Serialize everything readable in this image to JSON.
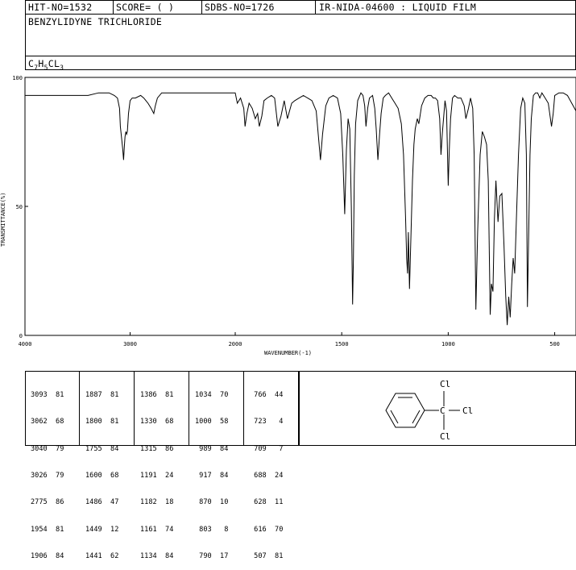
{
  "header": {
    "hit_no": "HIT-NO=1532",
    "score": "SCORE=  (   )",
    "sdbs_no": "SDBS-NO=1726",
    "ir_nida": "IR-NIDA-04600 : LIQUID FILM",
    "compound_name": "BENZYLIDYNE TRICHLORIDE",
    "formula_c": "C",
    "formula_7": "7",
    "formula_h": "H",
    "formula_5": "5",
    "formula_cl": "CL",
    "formula_3": "3"
  },
  "axes": {
    "ylabel": "TRANSMITTANCE(%)",
    "xlabel": "WAVENUMBER(-1)",
    "y_ticks": [
      "100",
      "50",
      "0"
    ],
    "x_ticks": [
      "4000",
      "3000",
      "2000",
      "1500",
      "1000",
      "500"
    ]
  },
  "peaks": {
    "col1": [
      "3093  81",
      "3062  68",
      "3040  79",
      "3026  79",
      "2775  86",
      "1954  81",
      "1906  84"
    ],
    "col2": [
      "1887  81",
      "1800  81",
      "1755  84",
      "1600  68",
      "1486  47",
      "1449  12",
      "1441  62"
    ],
    "col3": [
      "1386  81",
      "1330  68",
      "1315  86",
      "1191  24",
      "1182  18",
      "1161  74",
      "1134  84"
    ],
    "col4": [
      "1034  70",
      "1000  58",
      " 989  84",
      " 917  84",
      " 870  10",
      " 803   8",
      " 790  17"
    ],
    "col5": [
      " 766  44",
      " 723   4",
      " 709   7",
      " 688  24",
      " 628  11",
      " 616  70",
      " 507  81"
    ]
  },
  "structure": {
    "cl_top": "Cl",
    "cl_right": "Cl",
    "cl_bottom": "Cl"
  },
  "chart_data": {
    "type": "line",
    "xlabel": "WAVENUMBER(-1)",
    "ylabel": "TRANSMITTANCE(%)",
    "xlim": [
      4000,
      400
    ],
    "ylim": [
      0,
      100
    ],
    "x_axis_scale": "two-segment linear (4000-2000, 2000-400)",
    "series": [
      {
        "x": [
          4000,
          3900,
          3800,
          3700,
          3600,
          3500,
          3400,
          3300,
          3200,
          3150,
          3120,
          3100,
          3093,
          3080,
          3070,
          3062,
          3055,
          3048,
          3040,
          3033,
          3026,
          3015,
          3000,
          2980,
          2950,
          2900,
          2870,
          2850,
          2830,
          2800,
          2775,
          2760,
          2740,
          2700,
          2650,
          2600,
          2500,
          2400,
          2300,
          2200,
          2100,
          2050,
          2000,
          1990,
          1975,
          1960,
          1954,
          1945,
          1935,
          1920,
          1906,
          1895,
          1887,
          1875,
          1865,
          1850,
          1830,
          1815,
          1800,
          1785,
          1770,
          1755,
          1745,
          1735,
          1720,
          1700,
          1680,
          1660,
          1640,
          1620,
          1600,
          1590,
          1575,
          1560,
          1540,
          1520,
          1505,
          1495,
          1486,
          1478,
          1470,
          1462,
          1455,
          1449,
          1445,
          1441,
          1435,
          1425,
          1410,
          1400,
          1392,
          1386,
          1378,
          1370,
          1355,
          1345,
          1338,
          1330,
          1322,
          1315,
          1305,
          1295,
          1280,
          1265,
          1250,
          1235,
          1220,
          1210,
          1200,
          1195,
          1191,
          1187,
          1182,
          1176,
          1168,
          1161,
          1155,
          1145,
          1138,
          1134,
          1125,
          1110,
          1095,
          1080,
          1070,
          1060,
          1050,
          1040,
          1034,
          1028,
          1015,
          1008,
          1000,
          995,
          989,
          980,
          970,
          955,
          940,
          925,
          917,
          905,
          895,
          885,
          878,
          870,
          862,
          850,
          840,
          830,
          820,
          812,
          803,
          797,
          790,
          783,
          776,
          770,
          766,
          758,
          748,
          738,
          730,
          723,
          716,
          709,
          702,
          695,
          688,
          680,
          670,
          660,
          650,
          640,
          633,
          628,
          622,
          616,
          610,
          600,
          590,
          580,
          570,
          560,
          545,
          530,
          515,
          507,
          500,
          480,
          460,
          440,
          420,
          400
        ],
        "y": [
          93,
          93,
          93,
          93,
          93,
          93,
          93,
          94,
          94,
          93,
          92,
          88,
          81,
          76,
          72,
          68,
          73,
          77,
          79,
          78,
          79,
          86,
          91,
          92,
          92,
          93,
          92,
          91,
          90,
          88,
          86,
          89,
          92,
          94,
          94,
          94,
          94,
          94,
          94,
          94,
          94,
          94,
          94,
          90,
          92,
          88,
          81,
          86,
          90,
          88,
          84,
          86,
          81,
          85,
          91,
          92,
          93,
          92,
          81,
          85,
          91,
          84,
          87,
          90,
          91,
          92,
          93,
          92,
          91,
          87,
          68,
          78,
          89,
          92,
          93,
          92,
          86,
          70,
          47,
          72,
          84,
          80,
          50,
          12,
          30,
          62,
          82,
          91,
          94,
          93,
          89,
          81,
          88,
          92,
          93,
          88,
          80,
          68,
          78,
          86,
          92,
          93,
          94,
          92,
          90,
          88,
          82,
          70,
          45,
          30,
          24,
          40,
          18,
          35,
          60,
          74,
          80,
          84,
          82,
          84,
          89,
          92,
          93,
          93,
          92,
          92,
          91,
          84,
          70,
          78,
          91,
          87,
          58,
          72,
          84,
          92,
          93,
          92,
          92,
          89,
          84,
          88,
          92,
          88,
          70,
          10,
          40,
          70,
          79,
          77,
          74,
          60,
          8,
          20,
          17,
          45,
          60,
          50,
          44,
          54,
          55,
          35,
          15,
          4,
          15,
          7,
          20,
          30,
          24,
          45,
          70,
          88,
          92,
          90,
          70,
          11,
          40,
          70,
          84,
          93,
          94,
          94,
          92,
          94,
          92,
          90,
          81,
          86,
          93,
          94,
          94,
          93,
          90,
          87
        ]
      }
    ],
    "peak_table": [
      [
        3093,
        81
      ],
      [
        3062,
        68
      ],
      [
        3040,
        79
      ],
      [
        3026,
        79
      ],
      [
        2775,
        86
      ],
      [
        1954,
        81
      ],
      [
        1906,
        84
      ],
      [
        1887,
        81
      ],
      [
        1800,
        81
      ],
      [
        1755,
        84
      ],
      [
        1600,
        68
      ],
      [
        1486,
        47
      ],
      [
        1449,
        12
      ],
      [
        1441,
        62
      ],
      [
        1386,
        81
      ],
      [
        1330,
        68
      ],
      [
        1315,
        86
      ],
      [
        1191,
        24
      ],
      [
        1182,
        18
      ],
      [
        1161,
        74
      ],
      [
        1134,
        84
      ],
      [
        1034,
        70
      ],
      [
        1000,
        58
      ],
      [
        989,
        84
      ],
      [
        917,
        84
      ],
      [
        870,
        10
      ],
      [
        803,
        8
      ],
      [
        790,
        17
      ],
      [
        766,
        44
      ],
      [
        723,
        4
      ],
      [
        709,
        7
      ],
      [
        688,
        24
      ],
      [
        628,
        11
      ],
      [
        616,
        70
      ],
      [
        507,
        81
      ]
    ]
  }
}
